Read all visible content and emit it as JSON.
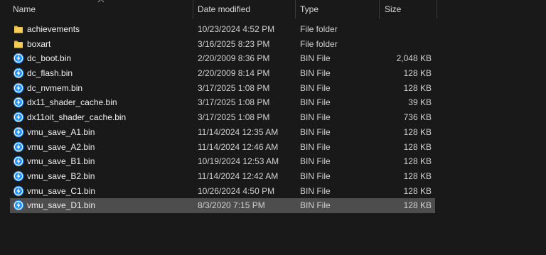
{
  "columns": {
    "name": "Name",
    "date": "Date modified",
    "type": "Type",
    "size": "Size"
  },
  "files": [
    {
      "name": "achievements",
      "date": "10/23/2024 4:52 PM",
      "type": "File folder",
      "size": "",
      "icon": "folder-icon"
    },
    {
      "name": "boxart",
      "date": "3/16/2025 8:23 PM",
      "type": "File folder",
      "size": "",
      "icon": "folder-icon"
    },
    {
      "name": "dc_boot.bin",
      "date": "2/20/2009 8:36 PM",
      "type": "BIN File",
      "size": "2,048 KB",
      "icon": "bin-file-icon"
    },
    {
      "name": "dc_flash.bin",
      "date": "2/20/2009 8:14 PM",
      "type": "BIN File",
      "size": "128 KB",
      "icon": "bin-file-icon"
    },
    {
      "name": "dc_nvmem.bin",
      "date": "3/17/2025 1:08 PM",
      "type": "BIN File",
      "size": "128 KB",
      "icon": "bin-file-icon"
    },
    {
      "name": "dx11_shader_cache.bin",
      "date": "3/17/2025 1:08 PM",
      "type": "BIN File",
      "size": "39 KB",
      "icon": "bin-file-icon"
    },
    {
      "name": "dx11oit_shader_cache.bin",
      "date": "3/17/2025 1:08 PM",
      "type": "BIN File",
      "size": "736 KB",
      "icon": "bin-file-icon"
    },
    {
      "name": "vmu_save_A1.bin",
      "date": "11/14/2024 12:35 AM",
      "type": "BIN File",
      "size": "128 KB",
      "icon": "bin-file-icon"
    },
    {
      "name": "vmu_save_A2.bin",
      "date": "11/14/2024 12:46 AM",
      "type": "BIN File",
      "size": "128 KB",
      "icon": "bin-file-icon"
    },
    {
      "name": "vmu_save_B1.bin",
      "date": "10/19/2024 12:53 AM",
      "type": "BIN File",
      "size": "128 KB",
      "icon": "bin-file-icon"
    },
    {
      "name": "vmu_save_B2.bin",
      "date": "11/14/2024 12:42 AM",
      "type": "BIN File",
      "size": "128 KB",
      "icon": "bin-file-icon"
    },
    {
      "name": "vmu_save_C1.bin",
      "date": "10/26/2024 4:50 PM",
      "type": "BIN File",
      "size": "128 KB",
      "icon": "bin-file-icon"
    },
    {
      "name": "vmu_save_D1.bin",
      "date": "8/3/2020 7:15 PM",
      "type": "BIN File",
      "size": "128 KB",
      "icon": "bin-file-icon",
      "selected": true
    }
  ],
  "colors": {
    "background": "#191919",
    "selection": "#4d4d4d",
    "folder": "#f4c64a",
    "bin_icon": "#1e90ff"
  }
}
